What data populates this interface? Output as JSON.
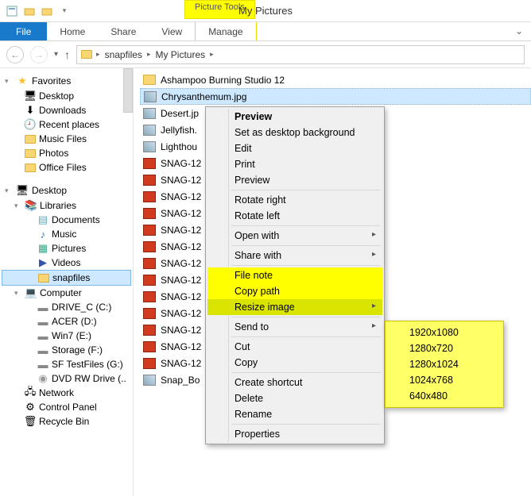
{
  "window": {
    "title": "My Pictures",
    "contextual_tab_label": "Picture Tools"
  },
  "ribbon": {
    "file": "File",
    "home": "Home",
    "share": "Share",
    "view": "View",
    "manage": "Manage"
  },
  "addressbar": {
    "seg1": "snapfiles",
    "seg2": "My Pictures"
  },
  "nav": {
    "favorites": {
      "label": "Favorites",
      "items": [
        "Desktop",
        "Downloads",
        "Recent places",
        "Music Files",
        "Photos",
        "Office Files"
      ]
    },
    "desktop": {
      "label": "Desktop",
      "libraries": {
        "label": "Libraries",
        "items": [
          "Documents",
          "Music",
          "Pictures",
          "Videos",
          "snapfiles"
        ]
      },
      "computer": {
        "label": "Computer",
        "items": [
          "DRIVE_C (C:)",
          "ACER (D:)",
          "Win7 (E:)",
          "Storage (F:)",
          "SF TestFiles (G:)",
          "DVD RW Drive (.."
        ]
      },
      "network": "Network",
      "controlpanel": "Control Panel",
      "recyclebin": "Recycle Bin"
    }
  },
  "files": {
    "folder1": "Ashampoo Burning Studio 12",
    "items": [
      "Chrysanthemum.jpg",
      "Desert.jp",
      "Jellyfish.",
      "Lighthou",
      "SNAG-12",
      "SNAG-12",
      "SNAG-12",
      "SNAG-12",
      "SNAG-12",
      "SNAG-12",
      "SNAG-12",
      "SNAG-12",
      "SNAG-12",
      "SNAG-12",
      "SNAG-12",
      "SNAG-12",
      "SNAG-12",
      "Snap_Bo"
    ]
  },
  "context_menu": {
    "preview": "Preview",
    "set_bg": "Set as desktop background",
    "edit": "Edit",
    "print": "Print",
    "preview2": "Preview",
    "rotate_right": "Rotate right",
    "rotate_left": "Rotate left",
    "open_with": "Open with",
    "share_with": "Share with",
    "file_note": "File note",
    "copy_path": "Copy path",
    "resize_image": "Resize image",
    "send_to": "Send to",
    "cut": "Cut",
    "copy": "Copy",
    "create_shortcut": "Create shortcut",
    "delete": "Delete",
    "rename": "Rename",
    "properties": "Properties"
  },
  "resize_submenu": {
    "items": [
      "1920x1080",
      "1280x720",
      "1280x1024",
      "1024x768",
      "640x480"
    ]
  }
}
